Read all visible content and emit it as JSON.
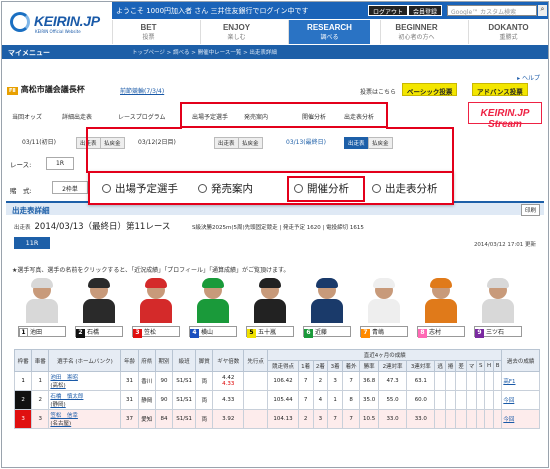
{
  "header": {
    "logo_text": "KEIRIN.JP",
    "logo_sub": "KEIRIN Official Website",
    "welcome": "ようこそ 1000円加入者 さん 三井住友銀行でログイン中です",
    "logout_label": "ログアウト",
    "register_label": "会員登録",
    "search_placeholder": "Google™ カスタム検索",
    "nav": [
      {
        "en": "BET",
        "jp": "投票"
      },
      {
        "en": "ENJOY",
        "jp": "楽しむ"
      },
      {
        "en": "RESEARCH",
        "jp": "調べる"
      },
      {
        "en": "BEGINNER",
        "jp": "初心者の方へ"
      },
      {
        "en": "DOKANTO",
        "jp": "重勝式"
      }
    ]
  },
  "mypage": {
    "label": "マイメニュー",
    "breadcrumb": "トップページ > 調べる > 開催中レース一覧 > 出走表詳細"
  },
  "help_label": "ヘルプ",
  "venue": {
    "tag": "FⅡ",
    "name": "高松市議会議長杯",
    "link": "前節競輪(7/3/4)",
    "vote_text": "投票はこちら",
    "basic_vote": "ベーシック投票",
    "advance_vote": "アドバンス投票"
  },
  "subnav": [
    "当回オッズ",
    "詳細出走表",
    "レースプログラム",
    "出場予定選手",
    "発売案内",
    "開催分析",
    "出走表分析"
  ],
  "stream_label": "KEIRIN.JP Stream",
  "dates": {
    "d1": "03/11(初日)",
    "d2": "03/12(2日目)",
    "d3": "03/13(最終日)",
    "btn_entry": "出走表",
    "btn_result": "払戻金"
  },
  "race_label": "レース:",
  "race_value": "1R",
  "type_label": "賭　式:",
  "type_value": "2枠単",
  "section_title": "出走表詳細",
  "print_label": "印刷",
  "race": {
    "label": "出走表",
    "title": "2014/03/13（最終日）第11レース",
    "meta": "S級決勝2025m(5周)先頭固定競走 | 発走予定 1620 | 電投締切 1615",
    "badge": "11R",
    "updated": "2014/03/12 17:01 更新"
  },
  "note": "★選手写真、選手の名前をクリックすると、「近況成績」「プロフィール」「通算成績」がご覧頂けます。",
  "riders": [
    {
      "no": "1",
      "name": "池田",
      "color": "#ffffff",
      "text": "#000000",
      "suit": "#d8d8d8"
    },
    {
      "no": "2",
      "name": "石橋",
      "color": "#111111",
      "text": "#ffffff",
      "suit": "#2a2a2a"
    },
    {
      "no": "3",
      "name": "笠松",
      "color": "#e01010",
      "text": "#ffffff",
      "suit": "#d42a2a"
    },
    {
      "no": "4",
      "name": "横山",
      "color": "#1a4fbf",
      "text": "#ffffff",
      "suit": "#1a9a3a"
    },
    {
      "no": "5",
      "name": "五十嵐",
      "color": "#f0e000",
      "text": "#000000",
      "suit": "#222222"
    },
    {
      "no": "6",
      "name": "近藤",
      "color": "#1a9a3a",
      "text": "#ffffff",
      "suit": "#1a3a6a"
    },
    {
      "no": "7",
      "name": "青嶋",
      "color": "#ff8a00",
      "text": "#ffffff",
      "suit": "#eeeeee"
    },
    {
      "no": "8",
      "name": "志村",
      "color": "#ff69b4",
      "text": "#ffffff",
      "suit": "#e07a1a"
    },
    {
      "no": "9",
      "name": "三ツ石",
      "color": "#7a2aa0",
      "text": "#ffffff",
      "suit": "#d8d8d8"
    }
  ],
  "table": {
    "headers": [
      "枠番",
      "車番",
      "選手名\n(ホームバンク)",
      "年齢",
      "府県",
      "期別",
      "級班",
      "脚質",
      "ギヤ倍数",
      "先行点",
      "競走得点",
      "1着",
      "2着",
      "3着",
      "着外",
      "勝率",
      "2連対率",
      "3連対率",
      "逃",
      "捲",
      "差",
      "マ",
      "S",
      "H",
      "B",
      "過去の成績"
    ],
    "group_header": "直近4ヶ月の成績",
    "rows": [
      {
        "waku": "1",
        "sha": "1",
        "name": "池田　憲昭",
        "home": "(高松)",
        "age": "31",
        "pref": "香川",
        "term": "90",
        "class": "S1/S1",
        "style": "両",
        "gear": "4.42",
        "gear2": "4.33",
        "score": "106.42",
        "w1": "7",
        "w2": "2",
        "w3": "3",
        "out": "7",
        "win": "36.8",
        "ren2": "47.3",
        "ren3": "63.1",
        "past": "高F1"
      },
      {
        "waku": "2",
        "sha": "2",
        "name": "石橋　慎太郎",
        "home": "(静岡)",
        "age": "31",
        "pref": "静岡",
        "term": "90",
        "class": "S1/S1",
        "style": "両",
        "gear": "4.33",
        "gear2": "",
        "score": "105.44",
        "w1": "7",
        "w2": "4",
        "w3": "1",
        "out": "8",
        "win": "35.0",
        "ren2": "55.0",
        "ren3": "60.0",
        "past": "今回"
      },
      {
        "waku": "3",
        "sha": "3",
        "name": "笠松　信幸",
        "home": "(名古屋)",
        "age": "37",
        "pref": "愛知",
        "term": "84",
        "class": "S1/S1",
        "style": "両",
        "gear": "3.92",
        "gear2": "",
        "score": "104.13",
        "w1": "2",
        "w2": "3",
        "w3": "7",
        "out": "7",
        "win": "10.5",
        "ren2": "33.0",
        "ren3": "33.0",
        "past": "今回"
      }
    ]
  },
  "callout": {
    "items": [
      "出場予定選手",
      "発売案内",
      "開催分析",
      "出走表分析"
    ],
    "selected": "開催分析"
  },
  "colors": {
    "brand_blue": "#1d5fa8",
    "highlight_red": "#e3001b",
    "vote_yellow": "#f3e600"
  }
}
